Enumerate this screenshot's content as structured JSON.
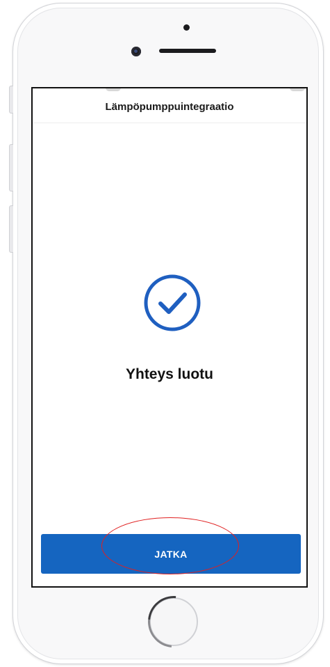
{
  "app": {
    "header_title": "Lämpöpumppuintegraatio"
  },
  "main": {
    "status_icon": "check-circle-icon",
    "status_text": "Yhteys luotu",
    "continue_label": "JATKA"
  },
  "colors": {
    "accent": "#1565c0",
    "check": "#1f5fc0",
    "annotation": "#e02020"
  },
  "device": {
    "hardware_icons": [
      "camera-icon",
      "speaker-icon",
      "home-button-icon"
    ]
  }
}
